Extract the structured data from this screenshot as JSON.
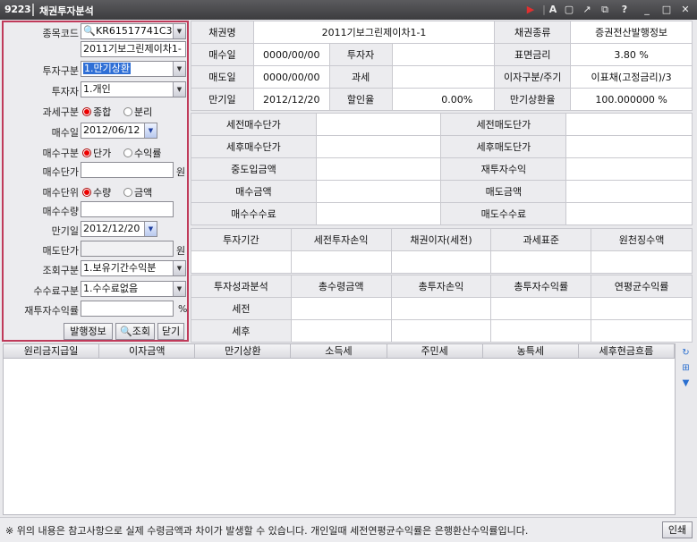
{
  "window": {
    "code": "9223",
    "title": "채권투자분석"
  },
  "left": {
    "item_code_label": "종목코드",
    "item_code": "KR61517741C3",
    "item_name": "2011기보그린제이차1-",
    "invest_type_label": "투자구분",
    "invest_type": "1.만기상환",
    "investor_label": "투자자",
    "investor": "1.개인",
    "tax_type_label": "과세구분",
    "tax_opt1": "종합",
    "tax_opt2": "분리",
    "buy_date_label": "매수일",
    "buy_date": "2012/06/12",
    "buy_type_label": "매수구분",
    "buy_opt1": "단가",
    "buy_opt2": "수익률",
    "buy_price_label": "매수단가",
    "won": "원",
    "buy_unit_label": "매수단위",
    "unit_opt1": "수량",
    "unit_opt2": "금액",
    "buy_qty_label": "매수수량",
    "maturity_label": "만기일",
    "maturity": "2012/12/20",
    "sell_price_label": "매도단가",
    "won2": "원",
    "inquiry_type_label": "조회구분",
    "inquiry_type": "1.보유기간수익분",
    "fee_type_label": "수수료구분",
    "fee_type": "1.수수료없음",
    "reinvest_label": "재투자수익률",
    "percent": "%",
    "btn_issue": "발행정보",
    "btn_search": "조회",
    "btn_close": "닫기"
  },
  "info": {
    "r1": [
      "채권명",
      "2011기보그린제이차1-1",
      "채권종류",
      "증권전산발행정보"
    ],
    "r2": [
      "매수일",
      "0000/00/00",
      "투자자",
      "",
      "표면금리",
      "3.80  %"
    ],
    "r3": [
      "매도일",
      "0000/00/00",
      "과세",
      "",
      "이자구분/주기",
      "이표채(고정금리)/3"
    ],
    "r4": [
      "만기일",
      "2012/12/20",
      "할인율",
      "0.00%",
      "만기상환율",
      "100.000000  %"
    ]
  },
  "price_rows": [
    [
      "세전매수단가",
      "세전매도단가"
    ],
    [
      "세후매수단가",
      "세후매도단가"
    ],
    [
      "중도입금액",
      "재투자수익"
    ],
    [
      "매수금액",
      "매도금액"
    ],
    [
      "매수수수료",
      "매도수수료"
    ]
  ],
  "period_headers": [
    "투자기간",
    "세전투자손익",
    "채권이자(세전)",
    "과세표준",
    "원천징수액"
  ],
  "perf_headers": [
    "투자성과분석",
    "총수령금액",
    "총투자손익",
    "총투자수익률",
    "연평균수익률"
  ],
  "perf_rows": [
    "세전",
    "세후"
  ],
  "bottom_headers": [
    "원리금지급일",
    "이자금액",
    "만기상환",
    "소득세",
    "주민세",
    "농특세",
    "세후현금흐름"
  ],
  "footer": {
    "message": "※ 위의 내용은 참고사항으로 실제 수령금액과 차이가 발생할 수 있습니다. 개인일때 세전연평균수익률은 은행환산수익률입니다.",
    "print": "인쇄"
  }
}
